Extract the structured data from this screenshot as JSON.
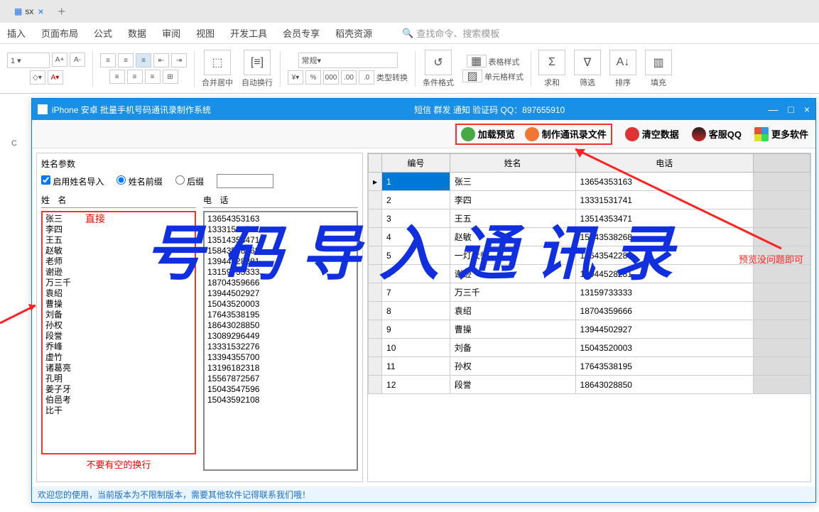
{
  "wps": {
    "tab_suffix": "sx",
    "menu": [
      "插入",
      "页面布局",
      "公式",
      "数据",
      "审阅",
      "视图",
      "开发工具",
      "会员专享",
      "稻壳资源"
    ],
    "search_placeholder": "查找命令、搜索模板",
    "ribbon": {
      "font_inc": "A+",
      "font_dec": "A-",
      "merge": "合并居中",
      "wrap": "自动换行",
      "numfmt": "常规",
      "typeconv": "类型转换",
      "condfmt": "条件格式",
      "tablestyle": "表格样式",
      "cellstyle": "单元格样式",
      "sum": "求和",
      "filter": "筛选",
      "sort": "排序",
      "fill": "填充"
    },
    "col_c": "C"
  },
  "app": {
    "title_left": "iPhone 安卓 批量手机号码通讯录制作系统",
    "title_center": "短信 群发 通知 验证码  QQ：897655910",
    "toolbar": {
      "load": "加载预览",
      "make": "制作通讯录文件",
      "clear": "清空数据",
      "qq": "客服QQ",
      "more": "更多软件"
    },
    "panel": {
      "fieldset": "姓名参数",
      "enable": "启用姓名导入",
      "prefix": "姓名前缀",
      "suffix": "后缀",
      "name_h": "姓 名",
      "phone_h": "电 话",
      "direct_note": "直接",
      "blank_note": "不要有空的换行"
    },
    "names": [
      "张三",
      "李四",
      "王五",
      "赵敏",
      "老师",
      "谢逊",
      "万三千",
      "袁绍",
      "曹操",
      "刘备",
      "孙权",
      "段誉",
      "乔峰",
      "虚竹",
      "诸葛亮",
      "孔明",
      "姜子牙",
      "伯邑考",
      "比干"
    ],
    "phones": [
      "13654353163",
      "13331531741",
      "13514353471",
      "15843538268",
      "13944528281",
      "13159733333",
      "18704359666",
      "13944502927",
      "15043520003",
      "17643538195",
      "18643028850",
      "13089296449",
      "13331532276",
      "13394355700",
      "13196182318",
      "15567872567",
      "15043547596",
      "15043592108"
    ],
    "grid": {
      "h_no": "编号",
      "h_name": "姓名",
      "h_phone": "电话",
      "rows": [
        {
          "no": "1",
          "name": "张三",
          "phone": "13654353163"
        },
        {
          "no": "2",
          "name": "李四",
          "phone": "13331531741"
        },
        {
          "no": "3",
          "name": "王五",
          "phone": "13514353471"
        },
        {
          "no": "4",
          "name": "赵敏",
          "phone": "15843538268"
        },
        {
          "no": "5",
          "name": "一灯大师",
          "phone": "18643542288"
        },
        {
          "no": "6",
          "name": "谢逊",
          "phone": "13944528281"
        },
        {
          "no": "7",
          "name": "万三千",
          "phone": "13159733333"
        },
        {
          "no": "8",
          "name": "袁绍",
          "phone": "18704359666"
        },
        {
          "no": "9",
          "name": "曹操",
          "phone": "13944502927"
        },
        {
          "no": "10",
          "name": "刘备",
          "phone": "15043520003"
        },
        {
          "no": "11",
          "name": "孙权",
          "phone": "17643538195"
        },
        {
          "no": "12",
          "name": "段誉",
          "phone": "18643028850"
        }
      ]
    },
    "status": "欢迎您的使用，当前版本为不限制版本，需要其他软件记得联系我们哦！",
    "preview_note": "预览没问题即可"
  },
  "overlay": "号码导入通讯录"
}
